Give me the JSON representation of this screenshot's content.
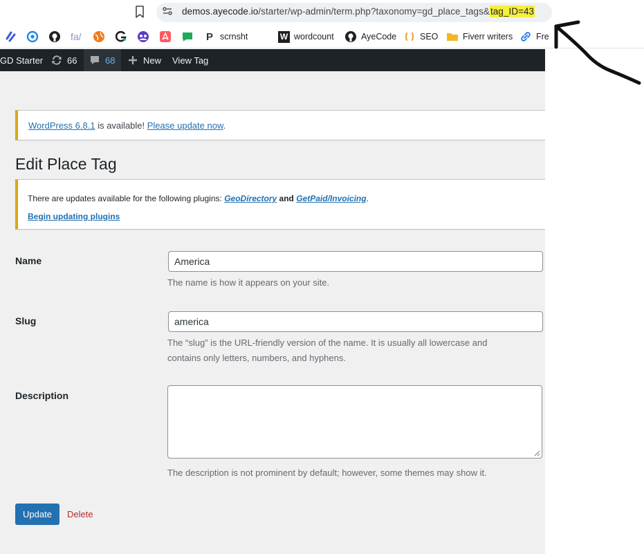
{
  "browser": {
    "url": {
      "host": "demos.ayecode.io",
      "path": "/starter/wp-admin/term.php?taxonomy=gd_place_tags&",
      "highlight": "tag_ID=43"
    },
    "bookmarks": [
      {
        "icon": "stripe-bolt-icon",
        "label": ""
      },
      {
        "icon": "circle-sync-icon",
        "label": ""
      },
      {
        "icon": "github-icon",
        "label": ""
      },
      {
        "icon": "fontawesome-icon",
        "label": "fa/"
      },
      {
        "icon": "orange-globe-icon",
        "label": ""
      },
      {
        "icon": "g-logo-icon",
        "label": ""
      },
      {
        "icon": "group-icon",
        "label": ""
      },
      {
        "icon": "airbnb-icon",
        "label": ""
      },
      {
        "icon": "chat-bubble-icon",
        "label": ""
      },
      {
        "icon": "p-letter-icon",
        "label": "scrnsht"
      },
      {
        "icon": "w-letter-icon",
        "label": "wordcount"
      },
      {
        "icon": "github-icon",
        "label": "AyeCode"
      },
      {
        "icon": "seo-icon",
        "label": "SEO"
      },
      {
        "icon": "folder-icon",
        "label": "Fiverr writers"
      },
      {
        "icon": "link-icon",
        "label": "Fre"
      }
    ]
  },
  "adminbar": {
    "site_name": "GD Starter",
    "updates_count": "66",
    "comments_count": "68",
    "new_label": "New",
    "view_tag_label": "View Tag"
  },
  "notices": {
    "wp_update": {
      "link1": "WordPress 6.8.1",
      "middle": " is available! ",
      "link2": "Please update now",
      "end": "."
    },
    "plugins": {
      "prefix": "There are updates available for the following plugins: ",
      "plugin1": "GeoDirectory",
      "and": " and ",
      "plugin2": "GetPaid/Invoicing",
      "end": ".",
      "begin_link": "Begin updating plugins"
    }
  },
  "page": {
    "title": "Edit Place Tag",
    "name_label": "Name",
    "name_value": "America",
    "name_desc": "The name is how it appears on your site.",
    "slug_label": "Slug",
    "slug_value": "america",
    "slug_desc_line1": "The “slug” is the URL-friendly version of the name. It is usually all lowercase and",
    "slug_desc_line2": "contains only letters, numbers, and hyphens.",
    "description_label": "Description",
    "description_value": "",
    "description_desc": "The description is not prominent by default; however, some themes may show it.",
    "update_button": "Update",
    "delete_link": "Delete"
  },
  "colors": {
    "admin_bar": "#1d2327",
    "primary": "#2271b1",
    "notice_warning": "#dba617",
    "delete": "#b32d2e",
    "url_highlight": "#f5ef3d"
  }
}
